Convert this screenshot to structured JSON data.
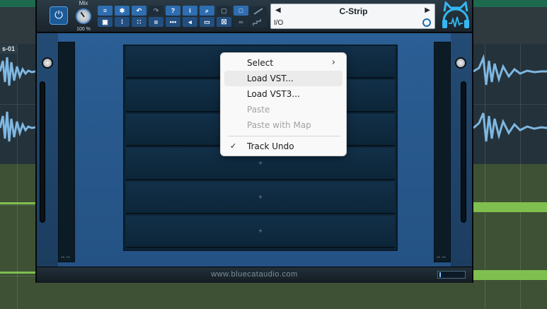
{
  "daw": {
    "clip_label": "s-01",
    "colors": {
      "top_strip": "#1e6a4f",
      "blue_track": "#24323b",
      "green_track": "#3e5135",
      "wave_blue": "#7fb7e0",
      "wave_green": "#7fbf4f"
    }
  },
  "plugin": {
    "name": "C-Strip",
    "io_label": "I/O",
    "mix": {
      "label": "Mix",
      "value": "100 %"
    },
    "power_icon": "power-icon",
    "toolbar_icons": [
      "menu-icon",
      "gear-icon",
      "undo-icon",
      "redo-icon",
      "help-icon",
      "info-icon",
      "search-icon",
      "lock-icon",
      "square-icon",
      "wrench-icon",
      "snapshot-icon",
      "sliders-icon",
      "grid-icon",
      "bars-icon",
      "dots-icon",
      "speaker-icon",
      "window-icon",
      "close-box-icon",
      "link-icon",
      "steps-icon"
    ],
    "slots": [
      {
        "label": ""
      },
      {
        "label": ""
      },
      {
        "label": ""
      },
      {
        "label": "+"
      },
      {
        "label": "+"
      },
      {
        "label": "+"
      }
    ],
    "meter_left": "-- --",
    "meter_right": "-- --",
    "footer_url": "www.bluecataudio.com",
    "accent_color": "#2e6db0"
  },
  "context_menu": {
    "items": [
      {
        "label": "Select",
        "submenu_arrow": "›",
        "disabled": false
      },
      {
        "label": "Load VST...",
        "disabled": false,
        "hovered": true
      },
      {
        "label": "Load VST3...",
        "disabled": false
      },
      {
        "label": "Paste",
        "disabled": true
      },
      {
        "label": "Paste with Map",
        "disabled": true
      },
      {
        "label": "Track Undo",
        "checked": true,
        "check_mark": "✓",
        "disabled": false
      }
    ]
  }
}
